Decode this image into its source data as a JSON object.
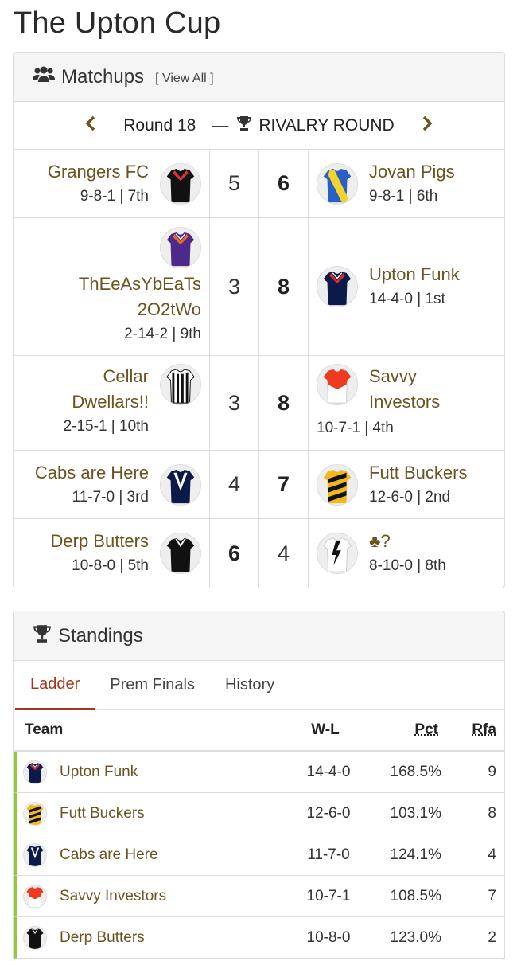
{
  "page": {
    "title": "The Upton Cup"
  },
  "matchups": {
    "header": {
      "icon": "users-icon",
      "title": "Matchups",
      "view_all": "[ View All ]"
    },
    "round": {
      "label": "Round 18",
      "separator": "—",
      "icon": "trophy-icon",
      "name": "RIVALRY ROUND"
    },
    "games": [
      {
        "home": {
          "name": "Grangers FC",
          "record": "9-8-1 | 7th",
          "guernsey": "black-red-chevron"
        },
        "home_score": "5",
        "away_score": "6",
        "away": {
          "name": "Jovan Pigs",
          "record": "9-8-1 | 6th",
          "guernsey": "blue-yellow-sash"
        }
      },
      {
        "home": {
          "name": "ThEeAsYbEaTs 2O2tWo",
          "record": "2-14-2 | 9th",
          "guernsey": "purple-chevron"
        },
        "home_score": "3",
        "away_score": "8",
        "away": {
          "name": "Upton Funk",
          "record": "14-4-0 | 1st",
          "guernsey": "navy-red-chevron"
        }
      },
      {
        "home": {
          "name": "Cellar Dwellars!!",
          "record": "2-15-1 | 10th",
          "guernsey": "black-white-stripes"
        },
        "home_score": "3",
        "away_score": "8",
        "away": {
          "name": "Savvy Investors",
          "record": "10-7-1 | 4th",
          "guernsey": "red-white"
        }
      },
      {
        "home": {
          "name": "Cabs are Here",
          "record": "11-7-0 | 3rd",
          "guernsey": "navy-white-v"
        },
        "home_score": "4",
        "away_score": "7",
        "away": {
          "name": "Futt Buckers",
          "record": "12-6-0 | 2nd",
          "guernsey": "black-yellow-stripes"
        }
      },
      {
        "home": {
          "name": "Derp Butters",
          "record": "10-8-0 | 5th",
          "guernsey": "black-white-v"
        },
        "home_score": "6",
        "away_score": "4",
        "away": {
          "name": "♣?",
          "record": "8-10-0 | 8th",
          "guernsey": "white-black-lightning"
        }
      }
    ]
  },
  "standings": {
    "header": {
      "icon": "trophy-icon",
      "title": "Standings"
    },
    "tabs": [
      "Ladder",
      "Prem Finals",
      "History"
    ],
    "columns": {
      "team": "Team",
      "wl": "W-L",
      "pct": "Pct",
      "rfa": "Rfa"
    },
    "rows": [
      {
        "team": "Upton Funk",
        "wl": "14-4-0",
        "pct": "168.5%",
        "rfa": "9",
        "guernsey": "navy-red-chevron"
      },
      {
        "team": "Futt Buckers",
        "wl": "12-6-0",
        "pct": "103.1%",
        "rfa": "8",
        "guernsey": "black-yellow-stripes"
      },
      {
        "team": "Cabs are Here",
        "wl": "11-7-0",
        "pct": "124.1%",
        "rfa": "4",
        "guernsey": "navy-white-v"
      },
      {
        "team": "Savvy Investors",
        "wl": "10-7-1",
        "pct": "108.5%",
        "rfa": "7",
        "guernsey": "red-white"
      },
      {
        "team": "Derp Butters",
        "wl": "10-8-0",
        "pct": "123.0%",
        "rfa": "2",
        "guernsey": "black-white-v"
      }
    ]
  }
}
